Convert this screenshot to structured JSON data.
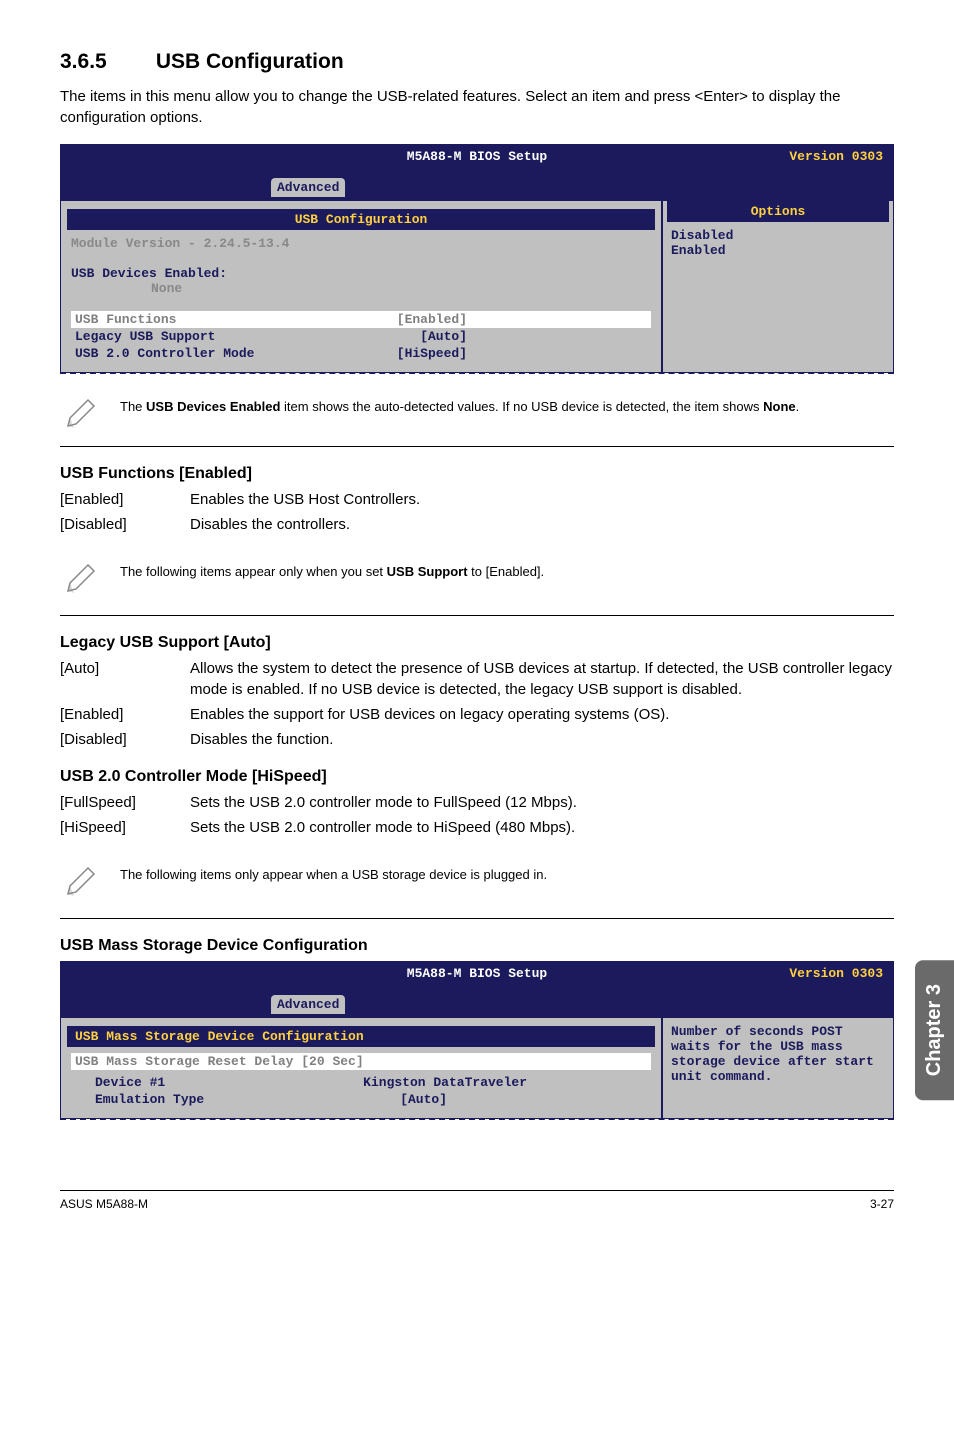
{
  "section": {
    "number": "3.6.5",
    "title": "USB Configuration"
  },
  "intro": "The items in this menu allow you to change the USB-related features. Select an item and press <Enter> to display the configuration options.",
  "bios1": {
    "title": "M5A88-M BIOS Setup",
    "version": "Version 0303",
    "tab": "Advanced",
    "section_title": "USB Configuration",
    "module": "Module Version - 2.24.5-13.4",
    "devices_label": "USB Devices Enabled:",
    "devices_value": "None",
    "rows": {
      "functions_label": "USB Functions",
      "functions_val": "[Enabled]",
      "legacy_label": "Legacy USB Support",
      "legacy_val": "[Auto]",
      "ctrl_label": "USB 2.0 Controller Mode",
      "ctrl_val": "[HiSpeed]"
    },
    "options_header": "Options",
    "opt_disabled": "Disabled",
    "opt_enabled": "Enabled"
  },
  "note1": {
    "text_a": "The ",
    "bold_a": "USB Devices Enabled",
    "text_b": " item shows the auto-detected values. If no USB device is detected, the item shows ",
    "bold_b": "None",
    "text_c": "."
  },
  "usb_functions": {
    "heading": "USB Functions [Enabled]",
    "rows": [
      {
        "l": "[Enabled]",
        "r": "Enables the USB Host Controllers."
      },
      {
        "l": "[Disabled]",
        "r": "Disables the controllers."
      }
    ]
  },
  "note2": {
    "text_a": "The following items appear only when you set ",
    "bold": "USB Support",
    "text_b": " to [Enabled]."
  },
  "legacy": {
    "heading": "Legacy USB Support [Auto]",
    "rows": [
      {
        "l": "[Auto]",
        "r": "Allows the system to detect the presence of USB devices at startup. If detected, the USB controller legacy mode is enabled. If no USB device is detected, the legacy USB support is disabled."
      },
      {
        "l": "[Enabled]",
        "r": "Enables the support for USB devices on legacy operating systems (OS)."
      },
      {
        "l": "[Disabled]",
        "r": "Disables the function."
      }
    ]
  },
  "ctrl_mode": {
    "heading": "USB 2.0 Controller Mode [HiSpeed]",
    "rows": [
      {
        "l": "[FullSpeed]",
        "r": "Sets the USB 2.0 controller mode to FullSpeed (12 Mbps)."
      },
      {
        "l": "[HiSpeed]",
        "r": "Sets the USB 2.0 controller mode to HiSpeed (480 Mbps)."
      }
    ]
  },
  "note3": "The following items only appear when a USB storage device is plugged in.",
  "mass_storage_heading": "USB Mass Storage Device Configuration",
  "bios2": {
    "title": "M5A88-M BIOS Setup",
    "version": "Version 0303",
    "tab": "Advanced",
    "section_title": "USB Mass Storage Device Configuration",
    "sel_row": "USB Mass Storage Reset Delay [20 Sec]",
    "device_label": "Device #1",
    "device_val": "Kingston DataTraveler",
    "emu_label": "Emulation Type",
    "emu_val": "[Auto]",
    "help": "Number of seconds POST waits for the USB mass storage device after start unit command."
  },
  "side_tab": "Chapter 3",
  "footer": {
    "left": "ASUS M5A88-M",
    "right": "3-27"
  }
}
